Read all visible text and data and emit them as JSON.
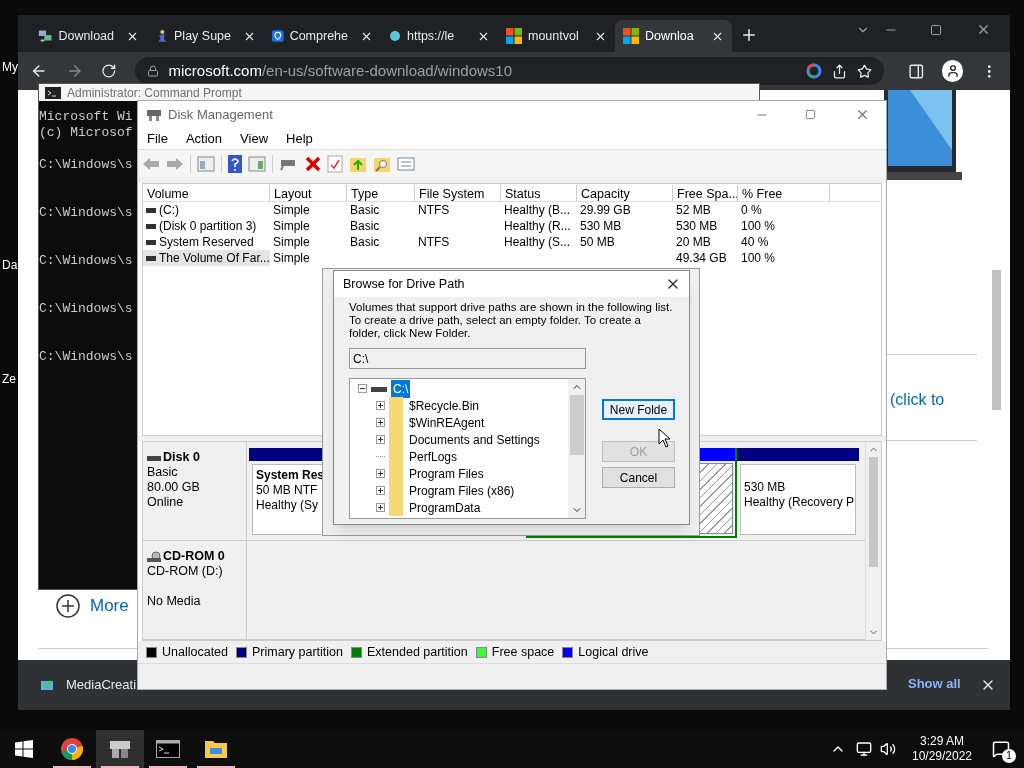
{
  "desktop": {
    "icon_labels": [
      "My",
      "Da",
      "Ze"
    ]
  },
  "browser": {
    "tabs": [
      {
        "title": "Download",
        "kind": "network",
        "selected": false
      },
      {
        "title": "Play Supe",
        "kind": "figure",
        "selected": false
      },
      {
        "title": "Comprehe",
        "kind": "shield",
        "selected": false
      },
      {
        "title": "https://le",
        "kind": "dot",
        "selected": false
      },
      {
        "title": "mountvol",
        "kind": "windows",
        "selected": false
      },
      {
        "title": "Downloa",
        "kind": "windows",
        "selected": true
      }
    ],
    "address": {
      "domain": "microsoft.com",
      "path": "/en-us/software-download/windows10"
    },
    "page": {
      "link_fragment": "(click to",
      "more_link": "More"
    },
    "downloads_bar": {
      "file": "MediaCreati",
      "show_all": "Show all"
    }
  },
  "cmd": {
    "title": "Administrator: Command Prompt",
    "header_lines": [
      "Microsoft Wi",
      "(c) Microsof"
    ],
    "prompts": [
      "C:\\Windows\\s",
      "C:\\Windows\\s",
      "C:\\Windows\\s",
      "C:\\Windows\\s",
      "C:\\Windows\\s"
    ]
  },
  "disk_management": {
    "title": "Disk Management",
    "menu": [
      "File",
      "Action",
      "View",
      "Help"
    ],
    "columns": [
      "Volume",
      "Layout",
      "Type",
      "File System",
      "Status",
      "Capacity",
      "Free Spa...",
      "% Free"
    ],
    "rows": [
      {
        "selected": false,
        "cells": [
          " (C:)",
          "Simple",
          "Basic",
          "NTFS",
          "Healthy (B...",
          "29.99 GB",
          "52 MB",
          "0 %"
        ]
      },
      {
        "selected": false,
        "cells": [
          "(Disk 0 partition 3)",
          "Simple",
          "Basic",
          null,
          "Healthy (R...",
          "530 MB",
          "530 MB",
          "100 %"
        ]
      },
      {
        "selected": false,
        "cells": [
          "System Reserved",
          "Simple",
          "Basic",
          "NTFS",
          "Healthy (S...",
          "50 MB",
          "20 MB",
          "40 %"
        ]
      },
      {
        "selected": true,
        "cells": [
          "The Volume Of Far...",
          "Simple",
          null,
          null,
          null,
          null,
          "49.34 GB",
          "100 %"
        ]
      }
    ],
    "disks": [
      {
        "kind": "disk",
        "name": "Disk 0",
        "lines": [
          "Basic",
          "80.00 GB",
          "Online"
        ],
        "partitions": [
          {
            "kind": "primary",
            "title": "System Res",
            "lines": [
              "50 MB NTF",
              "Healthy (Sy"
            ]
          },
          {
            "kind": "logical",
            "selected": true
          },
          {
            "kind": "primary",
            "lines": [
              "530 MB",
              "Healthy (Recovery P"
            ]
          }
        ]
      },
      {
        "kind": "cdrom",
        "name": "CD-ROM 0",
        "lines": [
          "CD-ROM (D:)",
          "No Media"
        ]
      }
    ],
    "legend": [
      {
        "label": "Unallocated",
        "color": "#000000"
      },
      {
        "label": "Primary partition",
        "color": "#000080"
      },
      {
        "label": "Extended partition",
        "color": "#008000"
      },
      {
        "label": "Free space",
        "color": "#33ff33"
      },
      {
        "label": "Logical drive",
        "color": "#0000ff"
      }
    ]
  },
  "dialog": {
    "title": "Browse for Drive Path",
    "description": "Volumes that support drive paths are shown in the following list.\nTo create a drive path, select an empty folder. To create a folder, click New Folder.",
    "path": "C:\\",
    "tree": {
      "label": "C:\\",
      "expanded": true,
      "selected": true,
      "children": [
        {
          "label": "$Recycle.Bin",
          "expandable": true
        },
        {
          "label": "$WinREAgent",
          "expandable": true
        },
        {
          "label": "Documents and Settings",
          "expandable": true
        },
        {
          "label": "PerfLogs",
          "expandable": false
        },
        {
          "label": "Program Files",
          "expandable": true
        },
        {
          "label": "Program Files (x86)",
          "expandable": true
        },
        {
          "label": "ProgramData",
          "expandable": true
        }
      ]
    },
    "buttons": [
      {
        "label": "New Folde",
        "focused": true,
        "disabled": false
      },
      {
        "label": "OK",
        "focused": false,
        "disabled": true
      },
      {
        "label": "Cancel",
        "focused": false,
        "disabled": false
      }
    ]
  },
  "taskbar": {
    "apps": [
      {
        "kind": "chrome",
        "active": false,
        "running": true
      },
      {
        "kind": "disk",
        "active": true,
        "running": true
      },
      {
        "kind": "cmd",
        "active": false,
        "running": true
      },
      {
        "kind": "explorer",
        "active": false,
        "running": true
      }
    ],
    "time": "3:29 AM",
    "date": "10/29/2022",
    "notifications": "1"
  }
}
